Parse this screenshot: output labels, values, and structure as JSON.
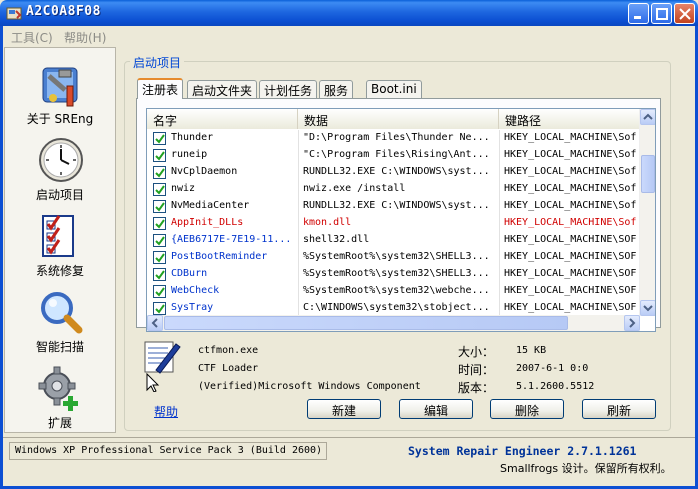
{
  "window": {
    "title": "A2C0A8F08"
  },
  "menu": {
    "tools": "工具(C)",
    "help": "帮助(H)"
  },
  "nav": [
    {
      "label": "关于 SREng",
      "icon": "tools-icon"
    },
    {
      "label": "启动项目",
      "icon": "clock-icon"
    },
    {
      "label": "系统修复",
      "icon": "checklist-icon"
    },
    {
      "label": "智能扫描",
      "icon": "magnifier-icon"
    },
    {
      "label": "扩展",
      "icon": "gear-plus-icon"
    }
  ],
  "group": {
    "title": "启动项目"
  },
  "tabs": [
    "注册表",
    "启动文件夹",
    "计划任务",
    "服务",
    "Boot.ini"
  ],
  "list": {
    "columns": [
      "名字",
      "数据",
      "键路径"
    ],
    "rows": [
      {
        "name": "Thunder",
        "data": "\"D:\\Program Files\\Thunder Ne...",
        "key": "HKEY_LOCAL_MACHINE\\Sof",
        "style": "normal"
      },
      {
        "name": "runeip",
        "data": "\"C:\\Program Files\\Rising\\Ant...",
        "key": "HKEY_LOCAL_MACHINE\\Sof",
        "style": "normal"
      },
      {
        "name": "NvCplDaemon",
        "data": "RUNDLL32.EXE C:\\WINDOWS\\syst...",
        "key": "HKEY_LOCAL_MACHINE\\Sof",
        "style": "normal"
      },
      {
        "name": "nwiz",
        "data": "nwiz.exe /install",
        "key": "HKEY_LOCAL_MACHINE\\Sof",
        "style": "normal"
      },
      {
        "name": "NvMediaCenter",
        "data": "RUNDLL32.EXE C:\\WINDOWS\\syst...",
        "key": "HKEY_LOCAL_MACHINE\\Sof",
        "style": "normal"
      },
      {
        "name": "AppInit_DLLs",
        "data": "kmon.dll",
        "key": "HKEY_LOCAL_MACHINE\\Sof",
        "style": "alert"
      },
      {
        "name": "{AEB6717E-7E19-11...",
        "data": "shell32.dll",
        "key": "HKEY_LOCAL_MACHINE\\SOF",
        "style": "blue"
      },
      {
        "name": "PostBootReminder",
        "data": "%SystemRoot%\\system32\\SHELL3...",
        "key": "HKEY_LOCAL_MACHINE\\SOF",
        "style": "blue"
      },
      {
        "name": "CDBurn",
        "data": "%SystemRoot%\\system32\\SHELL3...",
        "key": "HKEY_LOCAL_MACHINE\\SOF",
        "style": "blue"
      },
      {
        "name": "WebCheck",
        "data": "%SystemRoot%\\system32\\webche...",
        "key": "HKEY_LOCAL_MACHINE\\SOF",
        "style": "blue"
      },
      {
        "name": "SysTray",
        "data": "C:\\WINDOWS\\system32\\stobject...",
        "key": "HKEY_LOCAL_MACHINE\\SOF",
        "style": "blue"
      }
    ]
  },
  "detail": {
    "file": "ctfmon.exe",
    "desc": "CTF Loader",
    "company": "(Verified)Microsoft Windows Component",
    "size_label": "大小：",
    "size_value": "15 KB",
    "time_label": "时间：",
    "time_value": "2007-6-1 0:0",
    "version_label": "版本：",
    "version_value": "5.1.2600.5512"
  },
  "actions": {
    "help": "帮助",
    "new": "新建",
    "edit": "编辑",
    "delete": "删除",
    "refresh": "刷新"
  },
  "status": {
    "os": "Windows XP Professional Service Pack 3 (Build 2600)",
    "product": "System Repair Engineer 2.7.1.1261",
    "copyright": "Smallfrogs 设计。保留所有权利。"
  }
}
